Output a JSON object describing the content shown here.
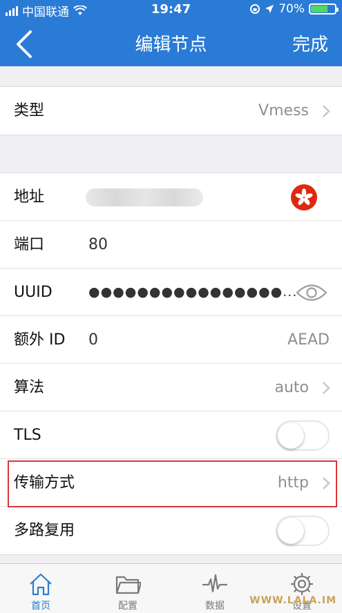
{
  "status_bar": {
    "carrier": "中国联通",
    "time": "19:47",
    "battery": "70%",
    "battery_level": 0.7
  },
  "nav": {
    "title": "编辑节点",
    "done_label": "完成",
    "back_icon": "chevron-left-icon"
  },
  "type_row": {
    "label": "类型",
    "value": "Vmess"
  },
  "rows": {
    "address": {
      "label": "地址",
      "flag_icon": "hong-kong-flag-icon"
    },
    "port": {
      "label": "端口",
      "value": "80"
    },
    "uuid": {
      "label": "UUID",
      "value": "●●●●●●●●●●●●●●●●..."
    },
    "alter_id": {
      "label": "额外 ID",
      "value": "0",
      "right": "AEAD"
    },
    "algorithm": {
      "label": "算法",
      "value": "auto"
    },
    "tls": {
      "label": "TLS",
      "on": false
    },
    "transport": {
      "label": "传输方式",
      "value": "http"
    },
    "mux": {
      "label": "多路复用",
      "on": false
    }
  },
  "tabs": [
    {
      "label": "首页",
      "icon": "home-icon",
      "active": true
    },
    {
      "label": "配置",
      "icon": "folder-icon",
      "active": false
    },
    {
      "label": "数据",
      "icon": "pulse-icon",
      "active": false
    },
    {
      "label": "设置",
      "icon": "gear-icon",
      "active": false
    }
  ],
  "watermark": "WWW.LALA.IM",
  "colors": {
    "accent": "#2a7bd6",
    "highlight": "#d9343a"
  }
}
